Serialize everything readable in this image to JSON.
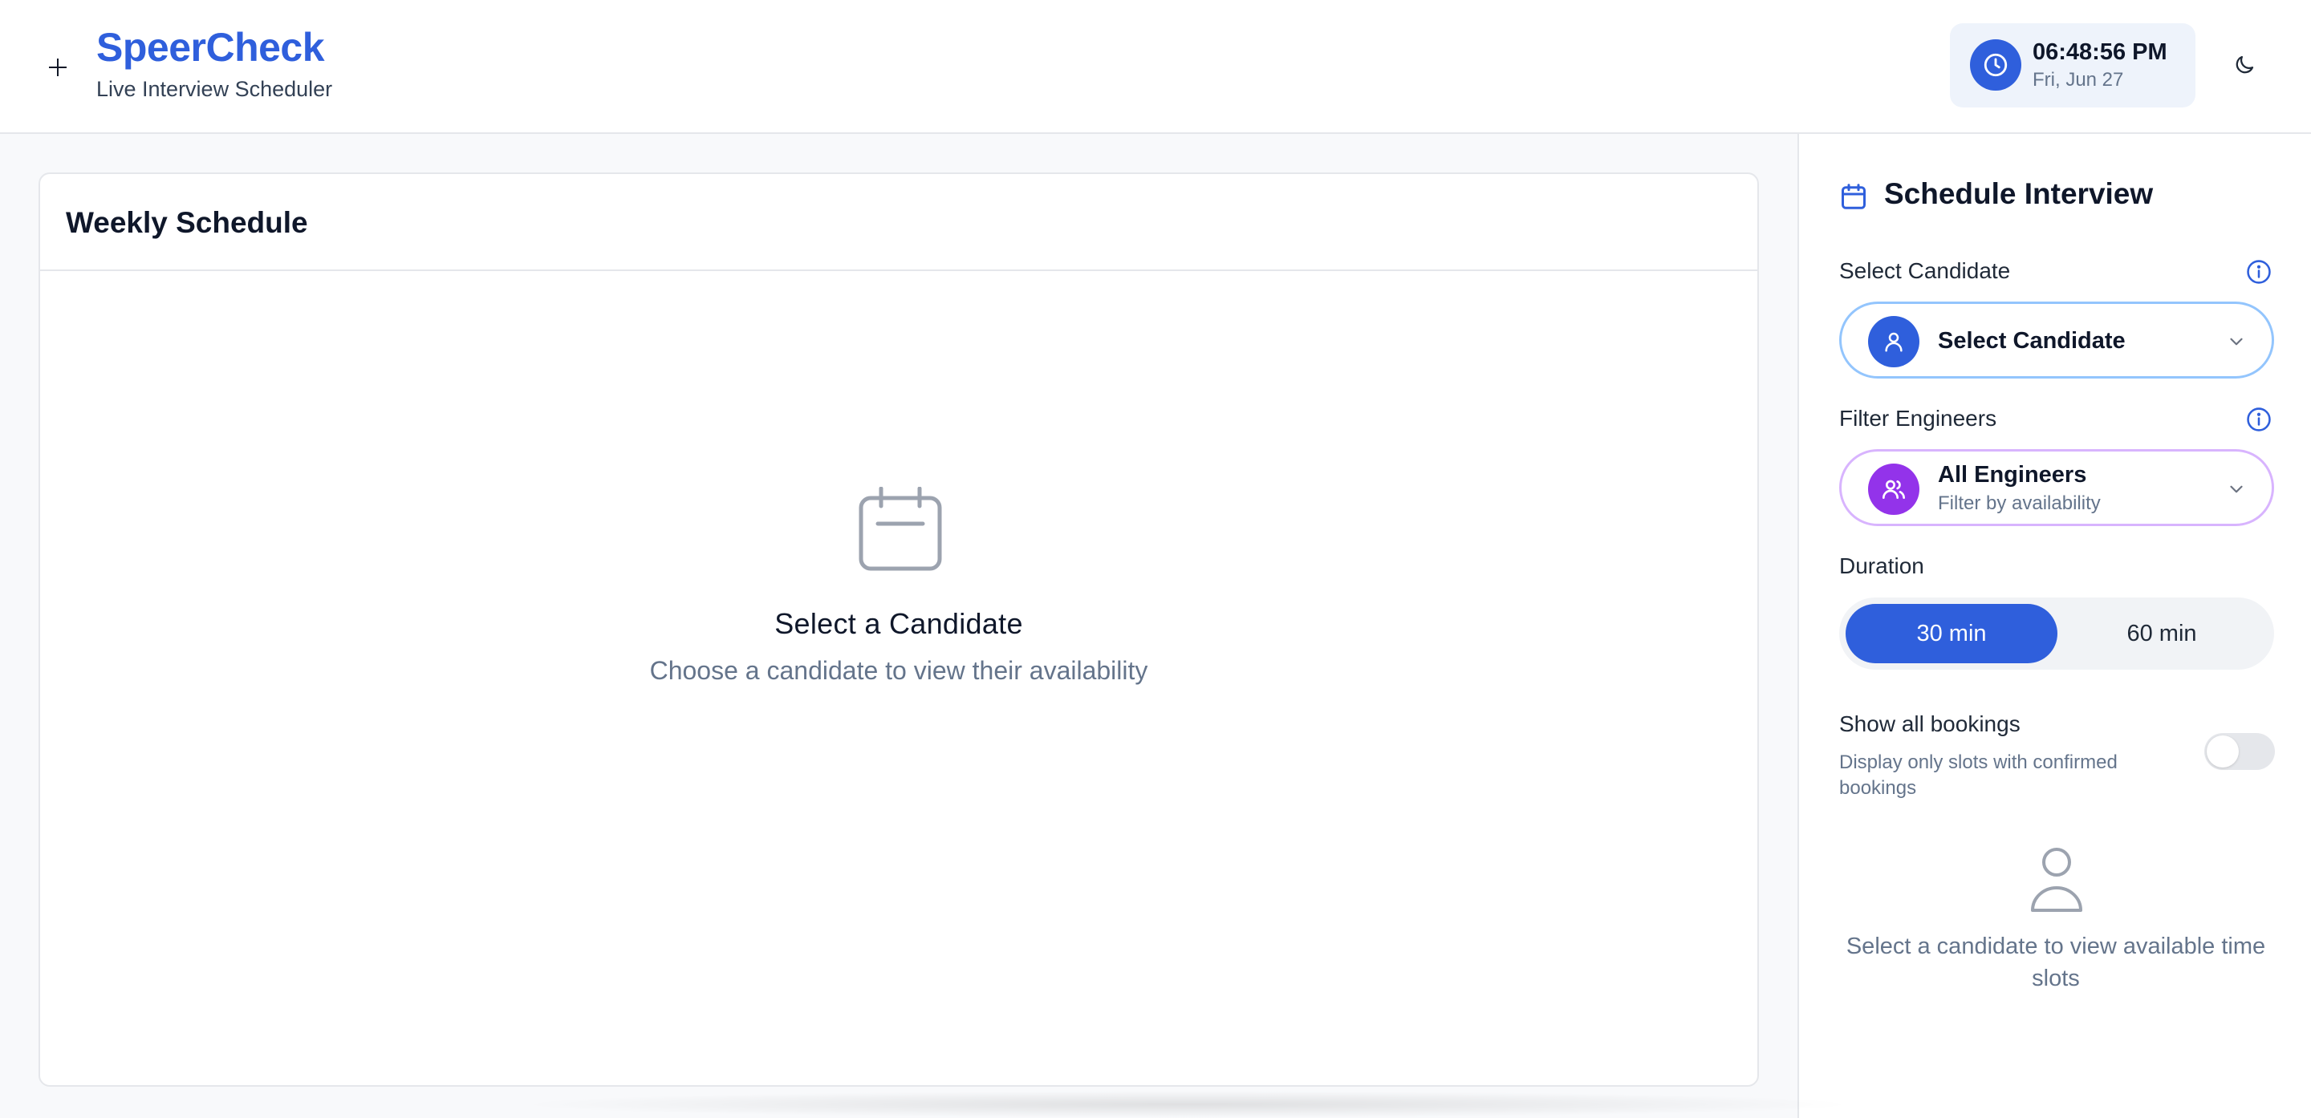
{
  "header": {
    "brand_title": "SpeerCheck",
    "brand_subtitle": "Live Interview Scheduler",
    "clock_time": "06:48:56 PM",
    "clock_date": "Fri, Jun 27",
    "icons": {
      "menu": "plus-icon",
      "clock": "clock-icon",
      "theme": "moon-icon"
    }
  },
  "main": {
    "card_title": "Weekly Schedule",
    "empty_title": "Select a Candidate",
    "empty_subtitle": "Choose a candidate to view their availability",
    "empty_icon": "calendar-icon"
  },
  "side": {
    "title": "Schedule Interview",
    "title_icon": "calendar-icon",
    "candidate": {
      "label": "Select Candidate",
      "value": "Select Candidate",
      "icon": "user-icon"
    },
    "engineers": {
      "label": "Filter Engineers",
      "value": "All Engineers",
      "sub": "Filter by availability",
      "icon": "users-icon"
    },
    "duration": {
      "label": "Duration",
      "options": [
        "30 min",
        "60 min"
      ],
      "selected": "30 min"
    },
    "show_all": {
      "label": "Show all bookings",
      "description": "Display only slots with confirmed bookings",
      "enabled": false
    },
    "empty_text": "Select a candidate to view available time slots"
  },
  "colors": {
    "accent": "#2f5fdc",
    "purple": "#9333ea",
    "candidate_border": "#93c5fd",
    "engineers_border": "#d8b4fe",
    "muted_text": "#64748b"
  }
}
